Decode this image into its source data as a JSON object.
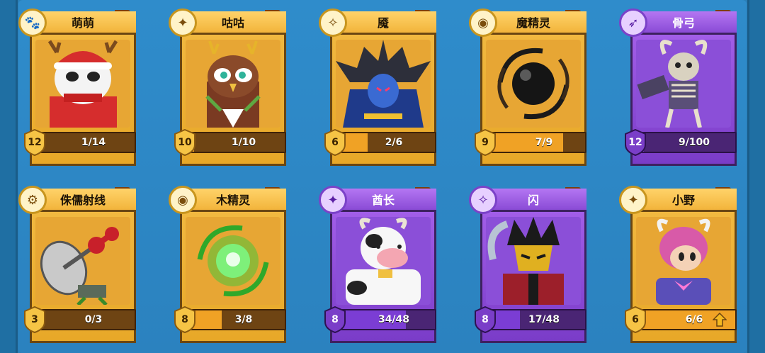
{
  "cards": [
    {
      "name": "萌萌",
      "role": "paw-icon",
      "rarity": "gold",
      "level": "12",
      "count": "1/14",
      "progress": 0.07
    },
    {
      "name": "咕咕",
      "role": "sparkle-icon",
      "rarity": "gold",
      "level": "10",
      "count": "1/10",
      "progress": 0.1
    },
    {
      "name": "魇",
      "role": "compass-icon",
      "rarity": "gold",
      "level": "6",
      "count": "2/6",
      "progress": 0.33
    },
    {
      "name": "魔精灵",
      "role": "orb-icon",
      "rarity": "gold",
      "level": "9",
      "count": "7/9",
      "progress": 0.78
    },
    {
      "name": "骨弓",
      "role": "bow-icon",
      "rarity": "purple",
      "level": "12",
      "count": "9/100",
      "progress": 0.09
    },
    {
      "name": "侏儒射线",
      "role": "gear-icon",
      "rarity": "gold",
      "level": "3",
      "count": "0/3",
      "progress": 0
    },
    {
      "name": "木精灵",
      "role": "orb-icon",
      "rarity": "gold",
      "level": "8",
      "count": "3/8",
      "progress": 0.375
    },
    {
      "name": "酋长",
      "role": "sparkle-icon",
      "rarity": "purple",
      "level": "8",
      "count": "34/48",
      "progress": 0.71
    },
    {
      "name": "闪",
      "role": "compass-icon",
      "rarity": "purple",
      "level": "8",
      "count": "17/48",
      "progress": 0.35
    },
    {
      "name": "小野",
      "role": "sparkle-icon",
      "rarity": "gold",
      "level": "6",
      "count": "6/6",
      "progress": 1.0,
      "upgradable": true
    }
  ]
}
